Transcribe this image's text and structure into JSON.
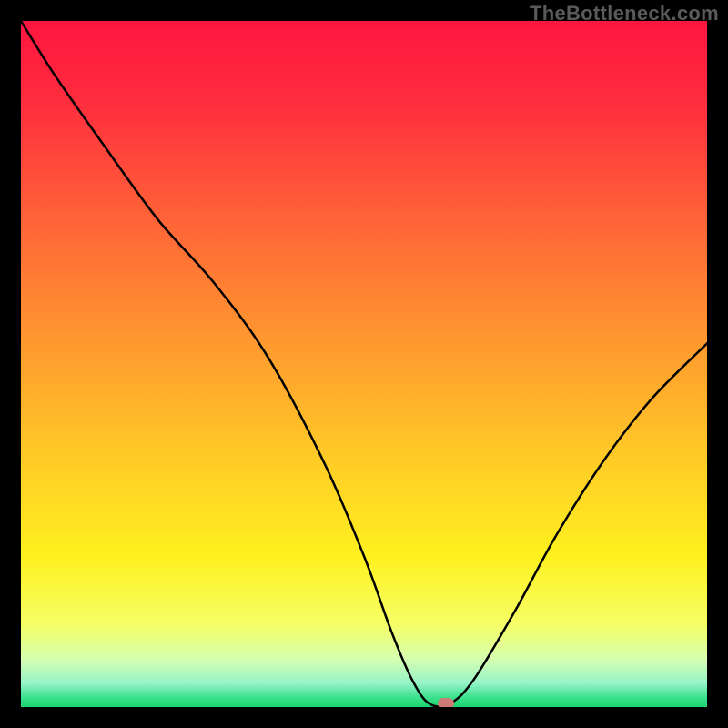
{
  "watermark": "TheBottleneck.com",
  "chart_data": {
    "type": "line",
    "title": "",
    "xlabel": "",
    "ylabel": "",
    "xlim": [
      0,
      100
    ],
    "ylim": [
      0,
      100
    ],
    "series": [
      {
        "name": "bottleneck-curve",
        "x": [
          0,
          5,
          12,
          20,
          28,
          36,
          44,
          50,
          54,
          57,
          59.5,
          62.5,
          66,
          72,
          78,
          85,
          92,
          100
        ],
        "y": [
          100,
          92,
          82,
          71,
          62,
          51,
          36,
          22,
          11,
          4,
          0.5,
          0.5,
          4,
          14,
          25,
          36,
          45,
          53
        ]
      }
    ],
    "marker": {
      "x": 62,
      "y": 0.5
    },
    "background": {
      "stops": [
        {
          "pct": 0,
          "color": "#ff153f"
        },
        {
          "pct": 12,
          "color": "#ff2e3e"
        },
        {
          "pct": 28,
          "color": "#ff6038"
        },
        {
          "pct": 45,
          "color": "#ff9330"
        },
        {
          "pct": 62,
          "color": "#ffc627"
        },
        {
          "pct": 78,
          "color": "#fff11f"
        },
        {
          "pct": 88,
          "color": "#f5ff66"
        },
        {
          "pct": 93,
          "color": "#d6ffb0"
        },
        {
          "pct": 96.5,
          "color": "#96f3c9"
        },
        {
          "pct": 98.5,
          "color": "#3ee28e"
        },
        {
          "pct": 100,
          "color": "#19d46f"
        }
      ]
    }
  }
}
